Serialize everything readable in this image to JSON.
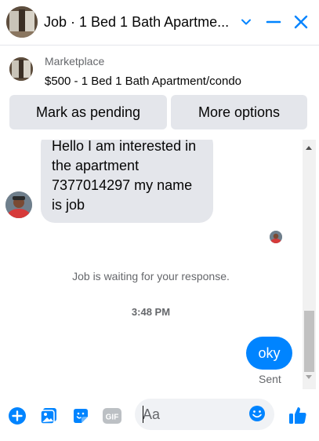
{
  "header": {
    "title": "Job · 1 Bed 1 Bath Apartme...",
    "icons": [
      "chevron-down-icon",
      "minimize-icon",
      "close-icon"
    ]
  },
  "marketplace": {
    "label": "Marketplace",
    "listing": "$500 - 1 Bed 1 Bath Apartment/condo",
    "buttons": {
      "mark_pending": "Mark as pending",
      "more_options": "More options"
    }
  },
  "messages": {
    "incoming": "Hello I am interested in the apartment 7377014297 my name is job",
    "waiting_notice": "Job is waiting for your response.",
    "timestamp": "3:48 PM",
    "outgoing": "oky",
    "status": "Sent"
  },
  "composer": {
    "placeholder": "Aa",
    "icons": [
      "add-icon",
      "photo-icon",
      "sticker-icon",
      "gif-icon",
      "emoji-icon",
      "thumbs-up-icon"
    ]
  },
  "colors": {
    "accent": "#0084ff",
    "bubble_gray": "#e4e6eb",
    "secondary_text": "#65676b"
  }
}
